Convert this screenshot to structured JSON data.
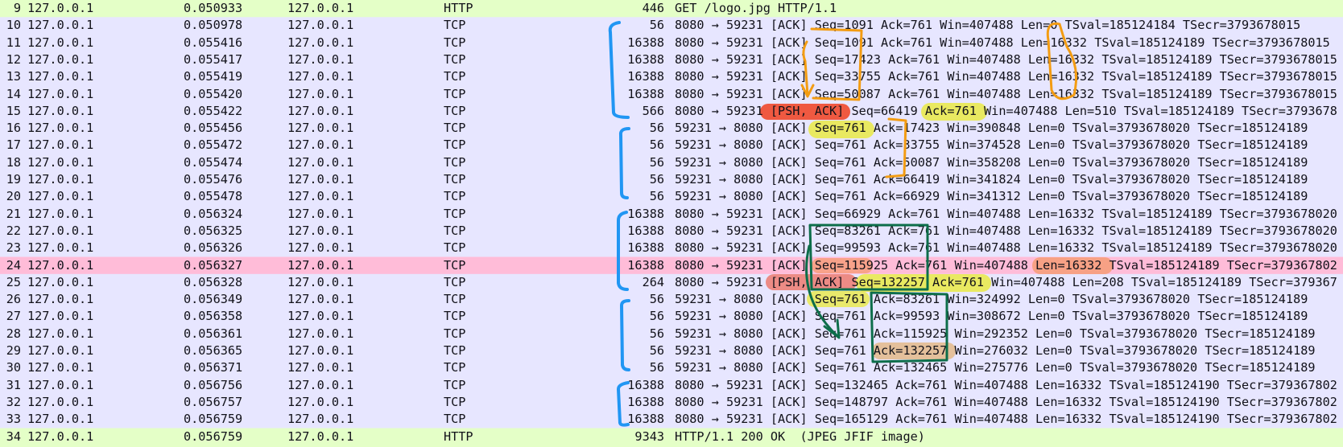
{
  "colors": {
    "tcp_row": "#e7e6ff",
    "http_row": "#e4ffc7",
    "selected_row": "#ffbcd8",
    "highlight_yellow": "#eaea3a",
    "highlight_red": "#f04020",
    "highlight_orange": "#f59a70",
    "highlight_tan": "#e3b88a",
    "ink_blue": "#2196f3",
    "ink_orange": "#f39c12",
    "ink_green": "#0d6e4a"
  },
  "packets": [
    {
      "no": "9",
      "src": "127.0.0.1",
      "time": "0.050933",
      "dst": "127.0.0.1",
      "proto": "HTTP",
      "len": "446",
      "info": "GET /logo.jpg HTTP/1.1",
      "style": "http"
    },
    {
      "no": "10",
      "src": "127.0.0.1",
      "time": "0.050978",
      "dst": "127.0.0.1",
      "proto": "TCP",
      "len": "56",
      "info": "8080 → 59231 [ACK] Seq=1091 Ack=761 Win=407488 Len=0 TSval=185124184 TSecr=3793678015",
      "style": "tcp"
    },
    {
      "no": "11",
      "src": "127.0.0.1",
      "time": "0.055416",
      "dst": "127.0.0.1",
      "proto": "TCP",
      "len": "16388",
      "info": "8080 → 59231 [ACK] Seq=1091 Ack=761 Win=407488 Len=16332 TSval=185124189 TSecr=3793678015",
      "style": "tcp"
    },
    {
      "no": "12",
      "src": "127.0.0.1",
      "time": "0.055417",
      "dst": "127.0.0.1",
      "proto": "TCP",
      "len": "16388",
      "info": "8080 → 59231 [ACK] Seq=17423 Ack=761 Win=407488 Len=16332 TSval=185124189 TSecr=3793678015",
      "style": "tcp"
    },
    {
      "no": "13",
      "src": "127.0.0.1",
      "time": "0.055419",
      "dst": "127.0.0.1",
      "proto": "TCP",
      "len": "16388",
      "info": "8080 → 59231 [ACK] Seq=33755 Ack=761 Win=407488 Len=16332 TSval=185124189 TSecr=3793678015",
      "style": "tcp"
    },
    {
      "no": "14",
      "src": "127.0.0.1",
      "time": "0.055420",
      "dst": "127.0.0.1",
      "proto": "TCP",
      "len": "16388",
      "info": "8080 → 59231 [ACK] Seq=50087 Ack=761 Win=407488 Len=16332 TSval=185124189 TSecr=3793678015",
      "style": "tcp"
    },
    {
      "no": "15",
      "src": "127.0.0.1",
      "time": "0.055422",
      "dst": "127.0.0.1",
      "proto": "TCP",
      "len": "566",
      "info": "8080 → 59231 [PSH, ACK] Seq=66419 Ack=761 Win=407488 Len=510 TSval=185124189 TSecr=3793678",
      "style": "tcp"
    },
    {
      "no": "16",
      "src": "127.0.0.1",
      "time": "0.055456",
      "dst": "127.0.0.1",
      "proto": "TCP",
      "len": "56",
      "info": "59231 → 8080 [ACK] Seq=761 Ack=17423 Win=390848 Len=0 TSval=3793678020 TSecr=185124189",
      "style": "tcp"
    },
    {
      "no": "17",
      "src": "127.0.0.1",
      "time": "0.055472",
      "dst": "127.0.0.1",
      "proto": "TCP",
      "len": "56",
      "info": "59231 → 8080 [ACK] Seq=761 Ack=33755 Win=374528 Len=0 TSval=3793678020 TSecr=185124189",
      "style": "tcp"
    },
    {
      "no": "18",
      "src": "127.0.0.1",
      "time": "0.055474",
      "dst": "127.0.0.1",
      "proto": "TCP",
      "len": "56",
      "info": "59231 → 8080 [ACK] Seq=761 Ack=50087 Win=358208 Len=0 TSval=3793678020 TSecr=185124189",
      "style": "tcp"
    },
    {
      "no": "19",
      "src": "127.0.0.1",
      "time": "0.055476",
      "dst": "127.0.0.1",
      "proto": "TCP",
      "len": "56",
      "info": "59231 → 8080 [ACK] Seq=761 Ack=66419 Win=341824 Len=0 TSval=3793678020 TSecr=185124189",
      "style": "tcp"
    },
    {
      "no": "20",
      "src": "127.0.0.1",
      "time": "0.055478",
      "dst": "127.0.0.1",
      "proto": "TCP",
      "len": "56",
      "info": "59231 → 8080 [ACK] Seq=761 Ack=66929 Win=341312 Len=0 TSval=3793678020 TSecr=185124189",
      "style": "tcp"
    },
    {
      "no": "21",
      "src": "127.0.0.1",
      "time": "0.056324",
      "dst": "127.0.0.1",
      "proto": "TCP",
      "len": "16388",
      "info": "8080 → 59231 [ACK] Seq=66929 Ack=761 Win=407488 Len=16332 TSval=185124189 TSecr=3793678020",
      "style": "tcp"
    },
    {
      "no": "22",
      "src": "127.0.0.1",
      "time": "0.056325",
      "dst": "127.0.0.1",
      "proto": "TCP",
      "len": "16388",
      "info": "8080 → 59231 [ACK] Seq=83261 Ack=761 Win=407488 Len=16332 TSval=185124189 TSecr=3793678020",
      "style": "tcp"
    },
    {
      "no": "23",
      "src": "127.0.0.1",
      "time": "0.056326",
      "dst": "127.0.0.1",
      "proto": "TCP",
      "len": "16388",
      "info": "8080 → 59231 [ACK] Seq=99593 Ack=761 Win=407488 Len=16332 TSval=185124189 TSecr=3793678020",
      "style": "tcp"
    },
    {
      "no": "24",
      "src": "127.0.0.1",
      "time": "0.056327",
      "dst": "127.0.0.1",
      "proto": "TCP",
      "len": "16388",
      "info": "8080 → 59231 [ACK] Seq=115925 Ack=761 Win=407488 Len=16332 TSval=185124189 TSecr=379367802",
      "style": "selected"
    },
    {
      "no": "25",
      "src": "127.0.0.1",
      "time": "0.056328",
      "dst": "127.0.0.1",
      "proto": "TCP",
      "len": "264",
      "info": "8080 → 59231 [PSH, ACK] Seq=132257 Ack=761 Win=407488 Len=208 TSval=185124189 TSecr=379367",
      "style": "tcp"
    },
    {
      "no": "26",
      "src": "127.0.0.1",
      "time": "0.056349",
      "dst": "127.0.0.1",
      "proto": "TCP",
      "len": "56",
      "info": "59231 → 8080 [ACK] Seq=761 Ack=83261 Win=324992 Len=0 TSval=3793678020 TSecr=185124189",
      "style": "tcp"
    },
    {
      "no": "27",
      "src": "127.0.0.1",
      "time": "0.056358",
      "dst": "127.0.0.1",
      "proto": "TCP",
      "len": "56",
      "info": "59231 → 8080 [ACK] Seq=761 Ack=99593 Win=308672 Len=0 TSval=3793678020 TSecr=185124189",
      "style": "tcp"
    },
    {
      "no": "28",
      "src": "127.0.0.1",
      "time": "0.056361",
      "dst": "127.0.0.1",
      "proto": "TCP",
      "len": "56",
      "info": "59231 → 8080 [ACK] Seq=761 Ack=115925 Win=292352 Len=0 TSval=3793678020 TSecr=185124189",
      "style": "tcp"
    },
    {
      "no": "29",
      "src": "127.0.0.1",
      "time": "0.056365",
      "dst": "127.0.0.1",
      "proto": "TCP",
      "len": "56",
      "info": "59231 → 8080 [ACK] Seq=761 Ack=132257 Win=276032 Len=0 TSval=3793678020 TSecr=185124189",
      "style": "tcp"
    },
    {
      "no": "30",
      "src": "127.0.0.1",
      "time": "0.056371",
      "dst": "127.0.0.1",
      "proto": "TCP",
      "len": "56",
      "info": "59231 → 8080 [ACK] Seq=761 Ack=132465 Win=275776 Len=0 TSval=3793678020 TSecr=185124189",
      "style": "tcp"
    },
    {
      "no": "31",
      "src": "127.0.0.1",
      "time": "0.056756",
      "dst": "127.0.0.1",
      "proto": "TCP",
      "len": "16388",
      "info": "8080 → 59231 [ACK] Seq=132465 Ack=761 Win=407488 Len=16332 TSval=185124190 TSecr=379367802",
      "style": "tcp"
    },
    {
      "no": "32",
      "src": "127.0.0.1",
      "time": "0.056757",
      "dst": "127.0.0.1",
      "proto": "TCP",
      "len": "16388",
      "info": "8080 → 59231 [ACK] Seq=148797 Ack=761 Win=407488 Len=16332 TSval=185124190 TSecr=379367802",
      "style": "tcp"
    },
    {
      "no": "33",
      "src": "127.0.0.1",
      "time": "0.056759",
      "dst": "127.0.0.1",
      "proto": "TCP",
      "len": "16388",
      "info": "8080 → 59231 [ACK] Seq=165129 Ack=761 Win=407488 Len=16332 TSval=185124190 TSecr=379367802",
      "style": "tcp"
    },
    {
      "no": "34",
      "src": "127.0.0.1",
      "time": "0.056759",
      "dst": "127.0.0.1",
      "proto": "HTTP",
      "len": "9343",
      "info": "HTTP/1.1 200 OK  (JPEG JFIF image)",
      "style": "http"
    }
  ]
}
